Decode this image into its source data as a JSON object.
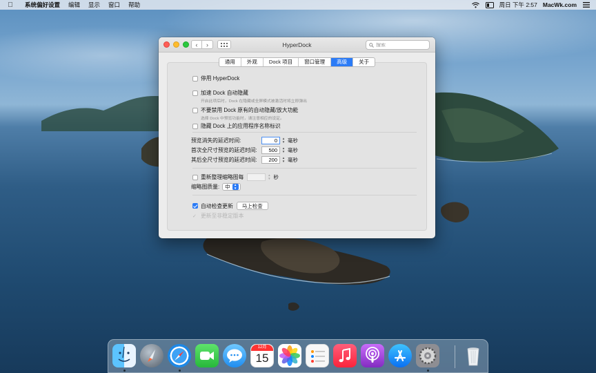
{
  "menubar": {
    "app_name": "系统偏好设置",
    "items": [
      "编辑",
      "显示",
      "窗口",
      "帮助"
    ],
    "clock": "周日 下午 2:57",
    "site": "MacWk.com"
  },
  "window": {
    "title": "HyperDock",
    "search_placeholder": "搜索",
    "tabs": [
      {
        "label": "通用",
        "active": false
      },
      {
        "label": "外观",
        "active": false
      },
      {
        "label": "Dock 项目",
        "active": false
      },
      {
        "label": "窗口管理",
        "active": false
      },
      {
        "label": "高级",
        "active": true
      },
      {
        "label": "关于",
        "active": false
      }
    ]
  },
  "settings": {
    "disable_label": "停用 HyperDock",
    "accelerate_label": "加速 Dock 自动隐藏",
    "accelerate_hint": "开启此项后时，Dock 在隐藏或全屏模式被激活时将立即弹出",
    "no_disable_label": "不要禁用 Dock 原有的自动隐藏/放大功能",
    "no_disable_hint": "选择 Dock 中预览功能时，请注意相应的设定。",
    "hide_names_label": "隐藏 Dock 上的应用程序名称标识",
    "delays": [
      {
        "label": "预览消失的延迟时间:",
        "value": "0",
        "unit": "毫秒",
        "focused": true
      },
      {
        "label": "首次全尺寸预览的延迟时间:",
        "value": "500",
        "unit": "毫秒",
        "focused": false
      },
      {
        "label": "其后全尺寸预览的延迟时间:",
        "value": "200",
        "unit": "毫秒",
        "focused": false
      }
    ],
    "refresh_label": "重新整理缩略图每",
    "refresh_value": "",
    "refresh_unit": "秒",
    "quality_label": "缩略图质量:",
    "quality_value": "中",
    "auto_update_label": "自动检查更新",
    "auto_update_checked": true,
    "check_now_button": "马上检查",
    "beta_label": "更新至非稳定版本"
  },
  "dock": {
    "apps": [
      {
        "name": "finder-icon",
        "color": "#3d9bf0",
        "running": true
      },
      {
        "name": "launchpad-icon",
        "color": "#7b8794",
        "running": false
      },
      {
        "name": "safari-icon",
        "color": "#1e88e5",
        "running": true
      },
      {
        "name": "facetime-icon",
        "color": "#34c759",
        "running": false
      },
      {
        "name": "messages-icon",
        "color": "#32a8ff",
        "running": false
      },
      {
        "name": "calendar-icon",
        "color": "#ffffff",
        "running": false
      },
      {
        "name": "photos-icon",
        "color": "#ffffff",
        "running": false
      },
      {
        "name": "reminders-icon",
        "color": "#f5f5f5",
        "running": false
      },
      {
        "name": "music-icon",
        "color": "#fb4a61",
        "running": false
      },
      {
        "name": "podcasts-icon",
        "color": "#9b3ff0",
        "running": false
      },
      {
        "name": "app-store-icon",
        "color": "#1a8cff",
        "running": false
      },
      {
        "name": "system-preferences-icon",
        "color": "#8e8e93",
        "running": true
      }
    ],
    "calendar_month": "12月",
    "calendar_day": "15",
    "trash": "trash-icon"
  }
}
